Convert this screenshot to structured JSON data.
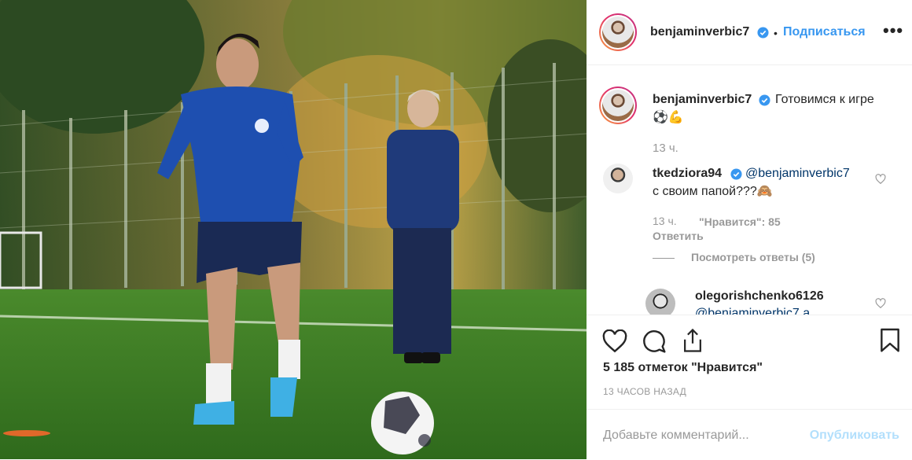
{
  "post": {
    "author": "benjaminverbic7",
    "dot": "•",
    "follow_label": "Подписаться",
    "more_label": "•••",
    "caption_text": "Готовимся к игре",
    "caption_emoji": "⚽💪",
    "caption_time": "13 ч.",
    "comments": [
      {
        "username": "tkedziora94",
        "mention": "@benjaminverbic7",
        "text": "с своим папой???🙈",
        "time": "13 ч.",
        "likes": "\"Нравится\": 85",
        "reply_label": "Ответить",
        "view_replies": "Посмотреть ответы (5)"
      },
      {
        "username": "olegorishchenko6126",
        "partial_text": "@benjaminverbic7 а ..."
      }
    ],
    "likes_count": "5 185 отметок \"Нравится\"",
    "time_ago": "13 ЧАСОВ НАЗАД",
    "comment_placeholder": "Добавьте комментарий...",
    "publish_label": "Опубликовать"
  },
  "colors": {
    "link_blue": "#3897f0",
    "verified_blue": "#3897f0",
    "publish_disabled": "#b2dffc",
    "text": "#262626",
    "muted": "#999999"
  },
  "icons": [
    "verified-icon",
    "heart-icon",
    "comment-icon",
    "share-icon",
    "bookmark-icon",
    "more-icon"
  ]
}
